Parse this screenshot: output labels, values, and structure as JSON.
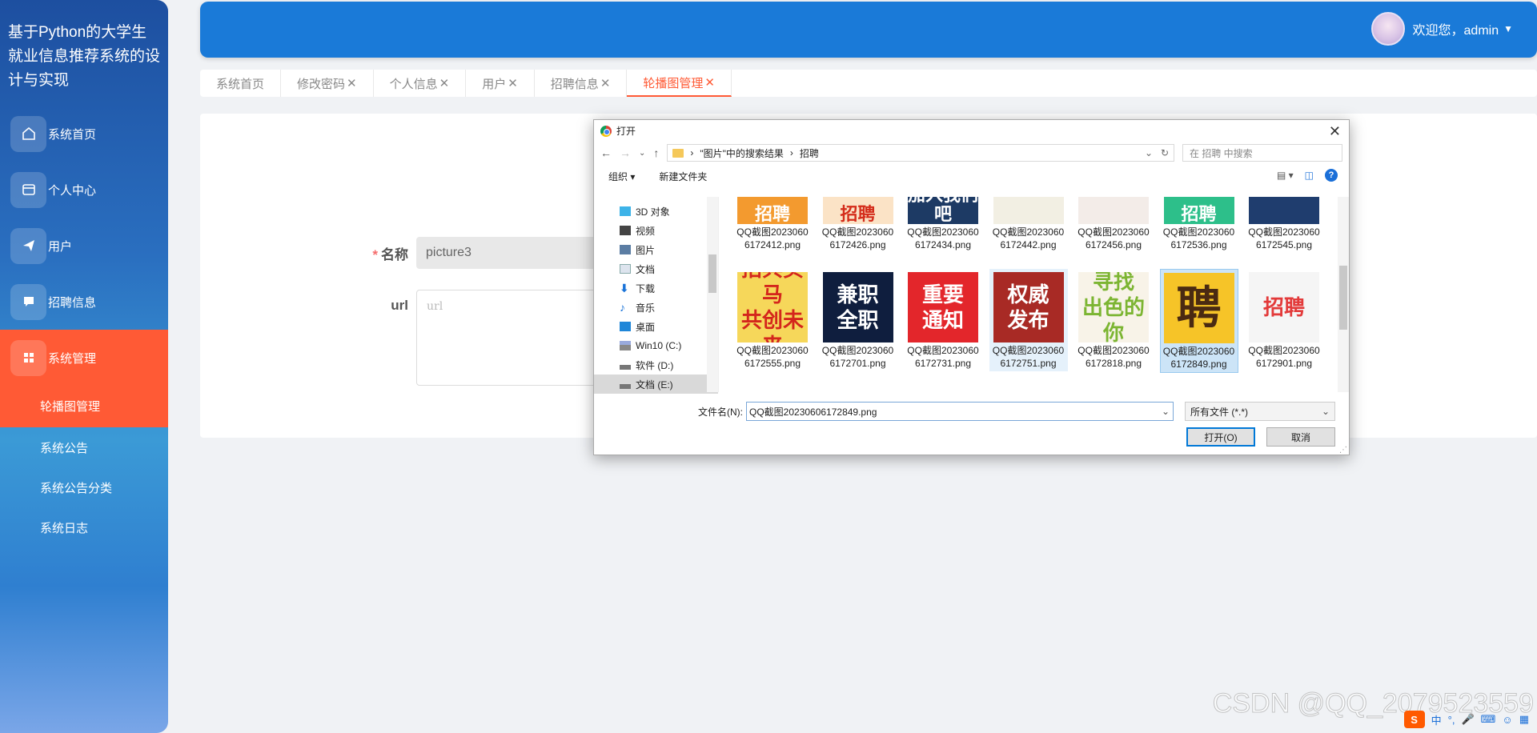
{
  "app": {
    "title": "基于Python的大学生就业信息推荐系统的设计与实现"
  },
  "sidebar": {
    "items": [
      {
        "label": "系统首页",
        "icon": "home-icon"
      },
      {
        "label": "个人中心",
        "icon": "id-card-icon"
      },
      {
        "label": "用户",
        "icon": "send-icon"
      },
      {
        "label": "招聘信息",
        "icon": "chat-icon"
      },
      {
        "label": "系统管理",
        "icon": "grid-icon"
      }
    ],
    "subitems": [
      {
        "label": "轮播图管理"
      },
      {
        "label": "系统公告"
      },
      {
        "label": "系统公告分类"
      },
      {
        "label": "系统日志"
      }
    ]
  },
  "header": {
    "welcome": "欢迎您，admin"
  },
  "tabs": [
    {
      "label": "系统首页",
      "close": ""
    },
    {
      "label": "修改密码",
      "close": "✕"
    },
    {
      "label": "个人信息",
      "close": "✕"
    },
    {
      "label": "用户",
      "close": "✕"
    },
    {
      "label": "招聘信息",
      "close": "✕"
    },
    {
      "label": "轮播图管理",
      "close": "✕"
    }
  ],
  "form": {
    "name_label": "名称",
    "name_required": "*",
    "name_value": "picture3",
    "url_label": "url",
    "url_placeholder": "url"
  },
  "dialog": {
    "title": "打开",
    "path": [
      "\"图片\"中的搜索结果",
      "招聘"
    ],
    "search_placeholder": "在 招聘 中搜索",
    "organize": "组织 ▾",
    "new_folder": "新建文件夹",
    "tree": [
      {
        "label": "3D 对象"
      },
      {
        "label": "视频"
      },
      {
        "label": "图片"
      },
      {
        "label": "文档"
      },
      {
        "label": "下载"
      },
      {
        "label": "音乐"
      },
      {
        "label": "桌面"
      },
      {
        "label": "Win10 (C:)"
      },
      {
        "label": "软件 (D:)"
      },
      {
        "label": "文档 (E:)"
      }
    ],
    "files_row1": [
      {
        "name": "QQ截图20230606172412.png",
        "thumb": "招聘",
        "bg": "#f39a2f",
        "fg": "#fff"
      },
      {
        "name": "QQ截图20230606172426.png",
        "thumb": "招聘",
        "bg": "#fbe3c6",
        "fg": "#d42c1a"
      },
      {
        "name": "QQ截图20230606172434.png",
        "thumb": "加入我们吧",
        "bg": "#1d3a64",
        "fg": "#fff"
      },
      {
        "name": "QQ截图20230606172442.png",
        "thumb": "",
        "bg": "#f2efe3",
        "fg": "#333"
      },
      {
        "name": "QQ截图20230606172456.png",
        "thumb": "",
        "bg": "#f3ece8",
        "fg": "#333"
      },
      {
        "name": "QQ截图20230606172536.png",
        "thumb": "招聘",
        "bg": "#2dbf8a",
        "fg": "#fff"
      },
      {
        "name": "QQ截图20230606172545.png",
        "thumb": "",
        "bg": "#1f3d6e",
        "fg": "#fff"
      }
    ],
    "files_row2": [
      {
        "name": "QQ截图20230606172555.png",
        "thumb": "招兵买马 共创未来",
        "bg": "#f6d75a",
        "fg": "#d4261c"
      },
      {
        "name": "QQ截图20230606172701.png",
        "thumb": "兼职 全职",
        "bg": "#0f1e3e",
        "fg": "#fff"
      },
      {
        "name": "QQ截图20230606172731.png",
        "thumb": "重要 通知",
        "bg": "#e3262b",
        "fg": "#fff"
      },
      {
        "name": "QQ截图20230606172751.png",
        "thumb": "权威 发布",
        "bg": "#a82a25",
        "fg": "#fff"
      },
      {
        "name": "QQ截图20230606172818.png",
        "thumb": "寻找 出色的你",
        "bg": "#f8f3e8",
        "fg": "#7cb532"
      },
      {
        "name": "QQ截图20230606172849.png",
        "thumb": "聘",
        "bg": "#f6c428",
        "fg": "#4a2a12"
      },
      {
        "name": "QQ截图20230606172901.png",
        "thumb": "招聘",
        "bg": "#f5f5f5",
        "fg": "#e33a3a"
      }
    ],
    "filename_label": "文件名(N):",
    "filename_value": "QQ截图20230606172849.png",
    "filetype": "所有文件 (*.*)",
    "open_btn": "打开(O)",
    "cancel_btn": "取消"
  },
  "watermark": "CSDN @QQ_2079523559",
  "tray": {
    "ime": "S",
    "lang": "中"
  }
}
